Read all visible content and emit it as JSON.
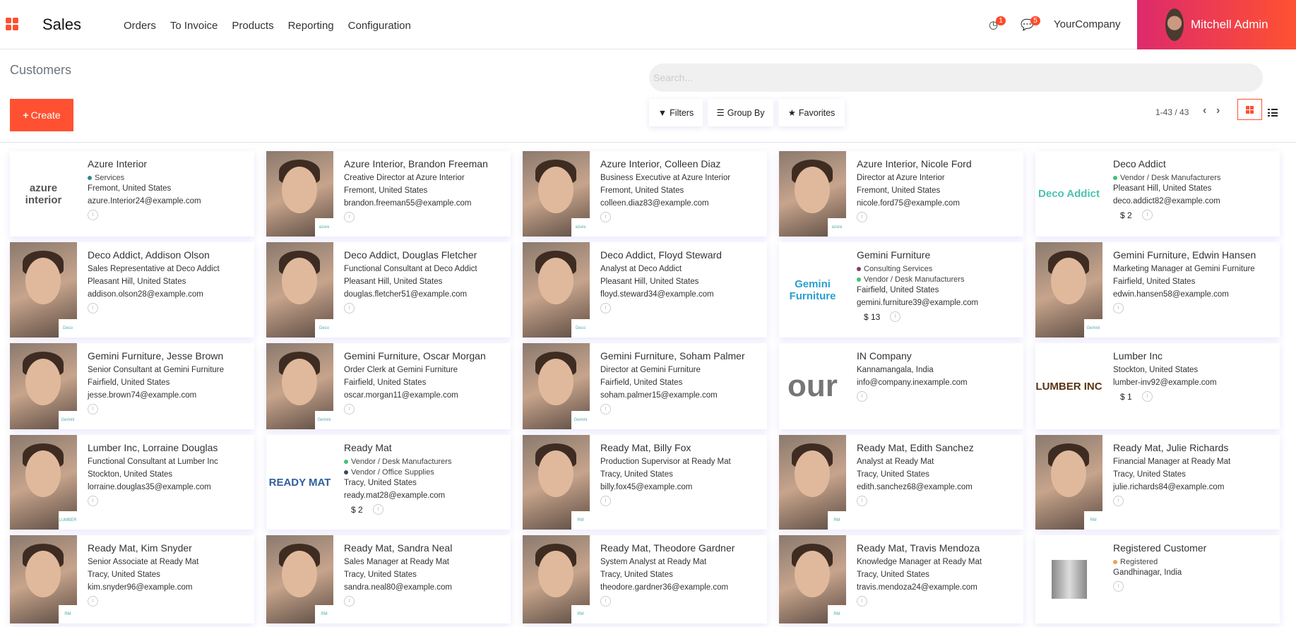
{
  "app": {
    "name": "Sales",
    "menu": [
      "Orders",
      "To Invoice",
      "Products",
      "Reporting",
      "Configuration"
    ],
    "activity_count": "1",
    "message_count": "5",
    "company": "YourCompany",
    "user": "Mitchell Admin",
    "accent": "#ff5131"
  },
  "page": {
    "title": "Customers",
    "create_label": "Create",
    "search_placeholder": "Search...",
    "filters_label": "Filters",
    "group_by_label": "Group By",
    "favorites_label": "Favorites",
    "pager": "1-43 / 43",
    "view": "kanban"
  },
  "tag_colors": {
    "Services": "#2a8c8c",
    "Vendor / Desk Manufacturers": "#3ec46d",
    "Consulting Services": "#7b3f6a",
    "Vendor / Office Supplies": "#34495e",
    "Registered": "#f0a050"
  },
  "cards": [
    {
      "name": "Azure Interior",
      "tags": [
        "Services"
      ],
      "lines": [
        "Fremont, United States",
        "azure.Interior24@example.com"
      ],
      "logo": "azure interior",
      "logo_color": "#555"
    },
    {
      "name": "Azure Interior, Brandon Freeman",
      "lines": [
        "Creative Director at Azure Interior",
        "Fremont, United States",
        "brandon.freeman55@example.com"
      ],
      "photo": true,
      "mini": "azure"
    },
    {
      "name": "Azure Interior, Colleen Diaz",
      "lines": [
        "Business Executive at Azure Interior",
        "Fremont, United States",
        "colleen.diaz83@example.com"
      ],
      "photo": true,
      "mini": "azure"
    },
    {
      "name": "Azure Interior, Nicole Ford",
      "lines": [
        "Director at Azure Interior",
        "Fremont, United States",
        "nicole.ford75@example.com"
      ],
      "photo": true,
      "mini": "azure"
    },
    {
      "name": "Deco Addict",
      "tags": [
        "Vendor / Desk Manufacturers"
      ],
      "lines": [
        "Pleasant Hill, United States",
        "deco.addict82@example.com"
      ],
      "amount": "$ 2",
      "logo": "Deco Addict",
      "logo_color": "#4cc2b0"
    },
    {
      "name": "Deco Addict, Addison Olson",
      "lines": [
        "Sales Representative at Deco Addict",
        "Pleasant Hill, United States",
        "addison.olson28@example.com"
      ],
      "photo": true,
      "mini": "Deco"
    },
    {
      "name": "Deco Addict, Douglas Fletcher",
      "lines": [
        "Functional Consultant at Deco Addict",
        "Pleasant Hill, United States",
        "douglas.fletcher51@example.com"
      ],
      "photo": true,
      "mini": "Deco"
    },
    {
      "name": "Deco Addict, Floyd Steward",
      "lines": [
        "Analyst at Deco Addict",
        "Pleasant Hill, United States",
        "floyd.steward34@example.com"
      ],
      "photo": true,
      "mini": "Deco"
    },
    {
      "name": "Gemini Furniture",
      "tags": [
        "Consulting Services",
        "Vendor / Desk Manufacturers"
      ],
      "lines": [
        "Fairfield, United States",
        "gemini.furniture39@example.com"
      ],
      "amount": "$ 13",
      "logo": "Gemini Furniture",
      "logo_color": "#2a9fd0"
    },
    {
      "name": "Gemini Furniture, Edwin Hansen",
      "lines": [
        "Marketing Manager at Gemini Furniture",
        "Fairfield, United States",
        "edwin.hansen58@example.com"
      ],
      "photo": true,
      "mini": "Gemini"
    },
    {
      "name": "Gemini Furniture, Jesse Brown",
      "lines": [
        "Senior Consultant at Gemini Furniture",
        "Fairfield, United States",
        "jesse.brown74@example.com"
      ],
      "photo": true,
      "mini": "Gemini"
    },
    {
      "name": "Gemini Furniture, Oscar Morgan",
      "lines": [
        "Order Clerk at Gemini Furniture",
        "Fairfield, United States",
        "oscar.morgan11@example.com"
      ],
      "photo": true,
      "mini": "Gemini"
    },
    {
      "name": "Gemini Furniture, Soham Palmer",
      "lines": [
        "Director at Gemini Furniture",
        "Fairfield, United States",
        "soham.palmer15@example.com"
      ],
      "photo": true,
      "mini": "Gemini"
    },
    {
      "name": "IN Company",
      "lines": [
        "Kannamangala, India",
        "info@company.inexample.com"
      ],
      "logo": "our",
      "logo_color": "#666"
    },
    {
      "name": "Lumber Inc",
      "lines": [
        "Stockton, United States",
        "lumber-inv92@example.com"
      ],
      "amount": "$ 1",
      "logo": "LUMBER INC",
      "logo_color": "#5a3413"
    },
    {
      "name": "Lumber Inc, Lorraine Douglas",
      "lines": [
        "Functional Consultant at Lumber Inc",
        "Stockton, United States",
        "lorraine.douglas35@example.com"
      ],
      "photo": true,
      "mini": "LUMBER"
    },
    {
      "name": "Ready Mat",
      "tags": [
        "Vendor / Desk Manufacturers",
        "Vendor / Office Supplies"
      ],
      "lines": [
        "Tracy, United States",
        "ready.mat28@example.com"
      ],
      "amount": "$ 2",
      "logo": "READY MAT",
      "logo_color": "#2f5e9e"
    },
    {
      "name": "Ready Mat, Billy Fox",
      "lines": [
        "Production Supervisor at Ready Mat",
        "Tracy, United States",
        "billy.fox45@example.com"
      ],
      "photo": true,
      "mini": "RM"
    },
    {
      "name": "Ready Mat, Edith Sanchez",
      "lines": [
        "Analyst at Ready Mat",
        "Tracy, United States",
        "edith.sanchez68@example.com"
      ],
      "photo": true,
      "mini": "RM"
    },
    {
      "name": "Ready Mat, Julie Richards",
      "lines": [
        "Financial Manager at Ready Mat",
        "Tracy, United States",
        "julie.richards84@example.com"
      ],
      "photo": true,
      "mini": "RM"
    },
    {
      "name": "Ready Mat, Kim Snyder",
      "lines": [
        "Senior Associate at Ready Mat",
        "Tracy, United States",
        "kim.snyder96@example.com"
      ],
      "photo": true,
      "mini": "RM"
    },
    {
      "name": "Ready Mat, Sandra Neal",
      "lines": [
        "Sales Manager at Ready Mat",
        "Tracy, United States",
        "sandra.neal80@example.com"
      ],
      "photo": true,
      "mini": "RM"
    },
    {
      "name": "Ready Mat, Theodore Gardner",
      "lines": [
        "System Analyst at Ready Mat",
        "Tracy, United States",
        "theodore.gardner36@example.com"
      ],
      "photo": true,
      "mini": "RM"
    },
    {
      "name": "Ready Mat, Travis Mendoza",
      "lines": [
        "Knowledge Manager at Ready Mat",
        "Tracy, United States",
        "travis.mendoza24@example.com"
      ],
      "photo": true,
      "mini": "RM"
    },
    {
      "name": "Registered Customer",
      "tags": [
        "Registered"
      ],
      "lines": [
        "Gandhinagar, India"
      ],
      "logo": "",
      "logo_color": "#999"
    }
  ]
}
